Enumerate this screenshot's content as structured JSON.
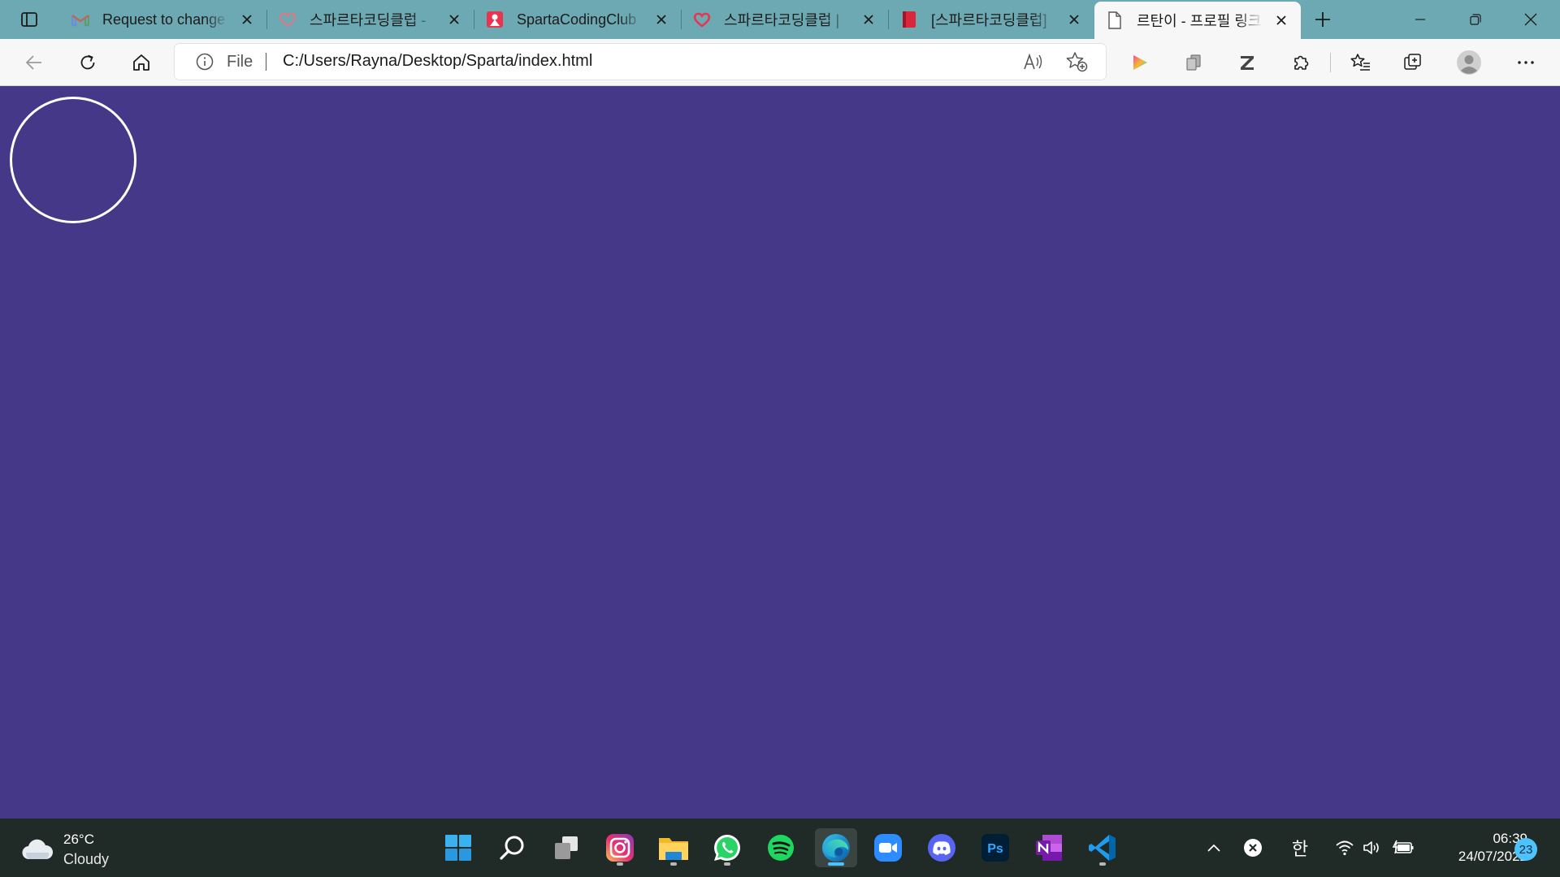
{
  "browser": {
    "tabs": [
      {
        "title": "Request to change t",
        "favicon": "gmail-icon",
        "active": false
      },
      {
        "title": "스파르타코딩클럽 - ",
        "favicon": "heart-chat-icon",
        "active": false
      },
      {
        "title": "SpartaCodingClub",
        "favicon": "sparta-icon",
        "active": false
      },
      {
        "title": "스파르타코딩클럽 |",
        "favicon": "heart-chat-icon",
        "active": false
      },
      {
        "title": "[스파르타코딩클럽] ",
        "favicon": "red-book-icon",
        "active": false
      },
      {
        "title": "르탄이 - 프로필 링크",
        "favicon": "blank-page-icon",
        "active": true
      }
    ],
    "address_bar": {
      "scheme_label": "File",
      "url": "C:/Users/Rayna/Desktop/Sparta/index.html"
    },
    "colors": {
      "tab_strip": "#6da9b2",
      "page_background": "#453889"
    }
  },
  "page": {
    "profile_circle": {
      "color": "#ffffff"
    }
  },
  "taskbar": {
    "weather": {
      "temperature": "26°C",
      "condition": "Cloudy"
    },
    "apps": [
      "windows-start-icon",
      "search-icon",
      "task-view-icon",
      "instagram-icon",
      "file-explorer-icon",
      "whatsapp-icon",
      "spotify-icon",
      "edge-icon",
      "zoom-icon",
      "discord-icon",
      "photoshop-icon",
      "onenote-icon",
      "vscode-icon"
    ],
    "tray": {
      "ime_label": "한"
    },
    "clock": {
      "time": "06:39",
      "date": "24/07/2022"
    },
    "notification_count": "23"
  }
}
